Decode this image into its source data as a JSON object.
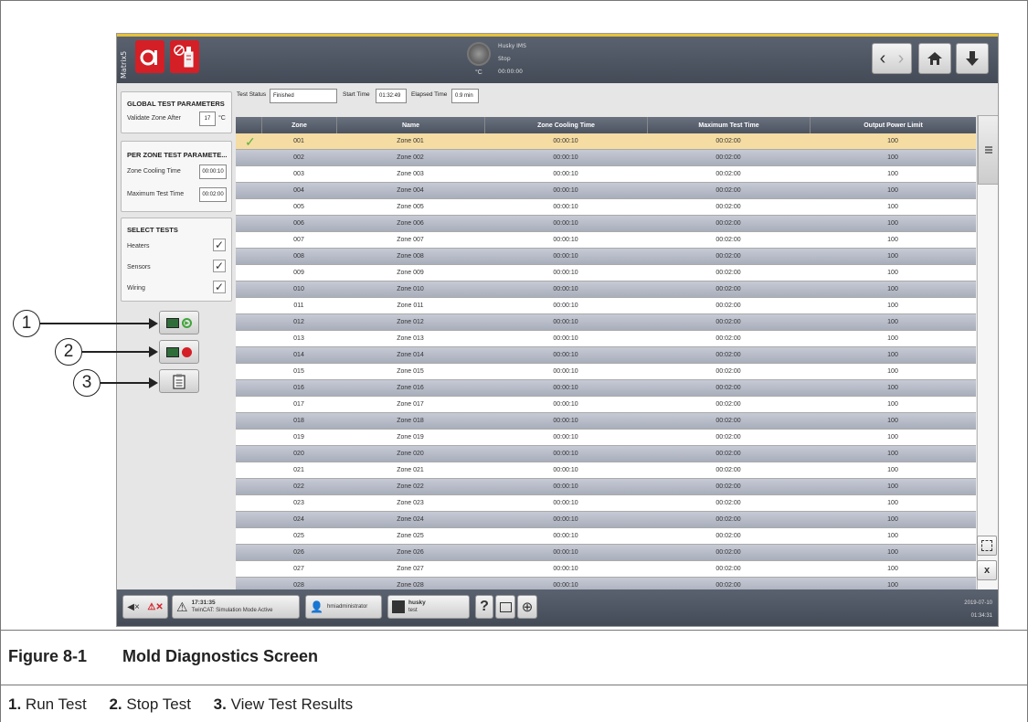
{
  "topbar": {
    "matrix_label": "Matrix5",
    "status_title": "Husky IMS",
    "status_state": "Stop",
    "status_time": "00:00:00",
    "status_unit": "°C"
  },
  "global_params": {
    "title": "GLOBAL TEST PARAMETERS",
    "validate_label": "Validate Zone After",
    "validate_value": "17",
    "validate_unit": "°C"
  },
  "zone_params": {
    "title": "PER ZONE TEST PARAMETE...",
    "cooling_label": "Zone Cooling Time",
    "cooling_value": "00:00:10",
    "max_label": "Maximum Test Time",
    "max_value": "00:02:00"
  },
  "select_tests": {
    "title": "SELECT TESTS",
    "items": [
      {
        "label": "Heaters",
        "checked": true
      },
      {
        "label": "Sensors",
        "checked": true
      },
      {
        "label": "Wiring",
        "checked": true
      }
    ]
  },
  "test_status": {
    "status_label": "Test Status",
    "status_value": "Finished",
    "start_label": "Start Time",
    "start_value": "01:32:49",
    "elapsed_label": "Elapsed Time",
    "elapsed_value": "0.9 min"
  },
  "table": {
    "columns": [
      "Zone",
      "Name",
      "Zone Cooling Time",
      "Maximum Test Time",
      "Output Power Limit"
    ],
    "rows": [
      [
        "001",
        "Zone 001",
        "00:00:10",
        "00:02:00",
        "100"
      ],
      [
        "002",
        "Zone 002",
        "00:00:10",
        "00:02:00",
        "100"
      ],
      [
        "003",
        "Zone 003",
        "00:00:10",
        "00:02:00",
        "100"
      ],
      [
        "004",
        "Zone 004",
        "00:00:10",
        "00:02:00",
        "100"
      ],
      [
        "005",
        "Zone 005",
        "00:00:10",
        "00:02:00",
        "100"
      ],
      [
        "006",
        "Zone 006",
        "00:00:10",
        "00:02:00",
        "100"
      ],
      [
        "007",
        "Zone 007",
        "00:00:10",
        "00:02:00",
        "100"
      ],
      [
        "008",
        "Zone 008",
        "00:00:10",
        "00:02:00",
        "100"
      ],
      [
        "009",
        "Zone 009",
        "00:00:10",
        "00:02:00",
        "100"
      ],
      [
        "010",
        "Zone 010",
        "00:00:10",
        "00:02:00",
        "100"
      ],
      [
        "011",
        "Zone 011",
        "00:00:10",
        "00:02:00",
        "100"
      ],
      [
        "012",
        "Zone 012",
        "00:00:10",
        "00:02:00",
        "100"
      ],
      [
        "013",
        "Zone 013",
        "00:00:10",
        "00:02:00",
        "100"
      ],
      [
        "014",
        "Zone 014",
        "00:00:10",
        "00:02:00",
        "100"
      ],
      [
        "015",
        "Zone 015",
        "00:00:10",
        "00:02:00",
        "100"
      ],
      [
        "016",
        "Zone 016",
        "00:00:10",
        "00:02:00",
        "100"
      ],
      [
        "017",
        "Zone 017",
        "00:00:10",
        "00:02:00",
        "100"
      ],
      [
        "018",
        "Zone 018",
        "00:00:10",
        "00:02:00",
        "100"
      ],
      [
        "019",
        "Zone 019",
        "00:00:10",
        "00:02:00",
        "100"
      ],
      [
        "020",
        "Zone 020",
        "00:00:10",
        "00:02:00",
        "100"
      ],
      [
        "021",
        "Zone 021",
        "00:00:10",
        "00:02:00",
        "100"
      ],
      [
        "022",
        "Zone 022",
        "00:00:10",
        "00:02:00",
        "100"
      ],
      [
        "023",
        "Zone 023",
        "00:00:10",
        "00:02:00",
        "100"
      ],
      [
        "024",
        "Zone 024",
        "00:00:10",
        "00:02:00",
        "100"
      ],
      [
        "025",
        "Zone 025",
        "00:00:10",
        "00:02:00",
        "100"
      ],
      [
        "026",
        "Zone 026",
        "00:00:10",
        "00:02:00",
        "100"
      ],
      [
        "027",
        "Zone 027",
        "00:00:10",
        "00:02:00",
        "100"
      ],
      [
        "028",
        "Zone 028",
        "00:00:10",
        "00:02:00",
        "100"
      ]
    ]
  },
  "bottombar": {
    "alarm_time": "17:31:35",
    "alarm_text": "TwinCAT: Simulation Mode Active",
    "user": "hmiadministrator",
    "mold_name": "husky",
    "mold_sub": "test",
    "help": "?",
    "date": "2019-07-10",
    "time": "01:34:31"
  },
  "callouts": [
    "1",
    "2",
    "3"
  ],
  "caption": {
    "figure_number": "Figure 8-1",
    "figure_title": "Mold Diagnostics Screen",
    "legend": [
      {
        "num": "1.",
        "text": "Run Test"
      },
      {
        "num": "2.",
        "text": "Stop Test"
      },
      {
        "num": "3.",
        "text": "View Test Results"
      }
    ]
  },
  "colors": {
    "accent_red": "#d41f26",
    "header_dark": "#4c5360",
    "selected_row": "#f5dca2",
    "check_green": "#5ab43a"
  }
}
